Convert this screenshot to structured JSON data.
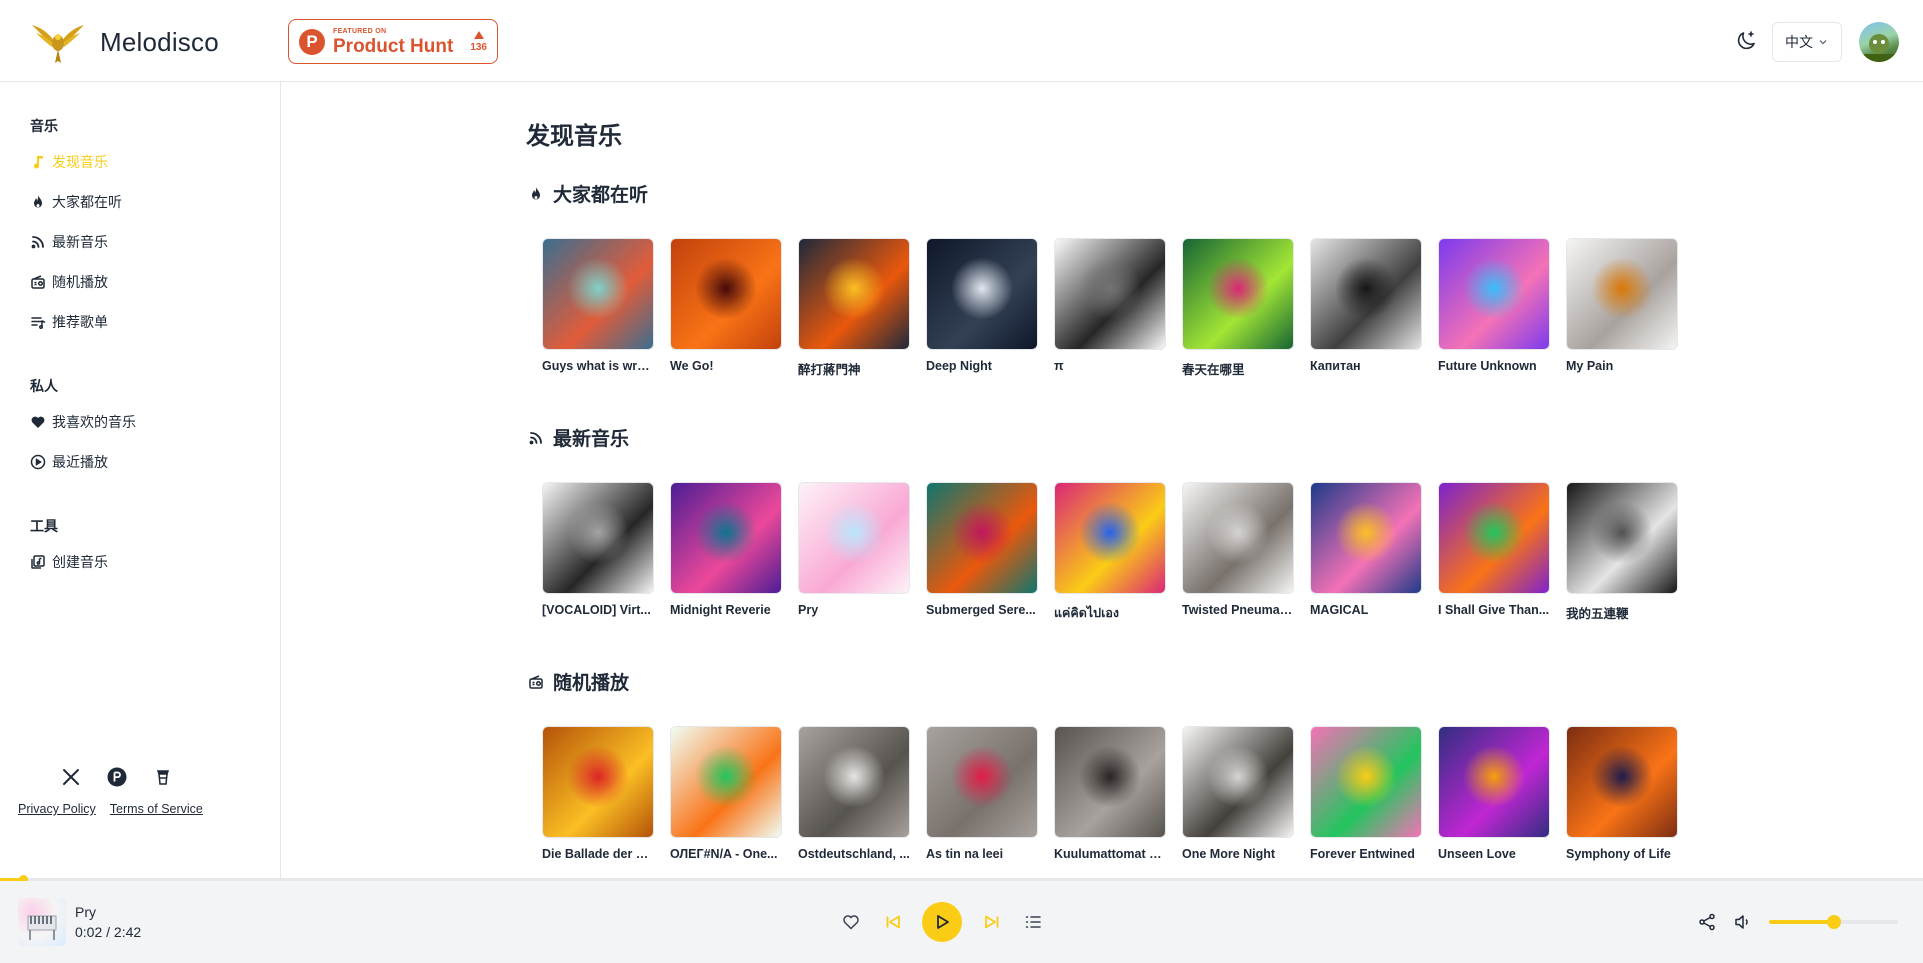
{
  "header": {
    "brand_name": "Melodisco",
    "product_hunt": {
      "featured": "FEATURED ON",
      "name": "Product Hunt",
      "votes": "136",
      "letter": "P"
    },
    "language": "中文"
  },
  "sidebar": {
    "sections": [
      {
        "title": "音乐",
        "items": [
          {
            "label": "发现音乐",
            "icon": "music-note-icon",
            "active": true
          },
          {
            "label": "大家都在听",
            "icon": "flame-icon"
          },
          {
            "label": "最新音乐",
            "icon": "rss-icon"
          },
          {
            "label": "随机播放",
            "icon": "radio-icon"
          },
          {
            "label": "推荐歌单",
            "icon": "playlist-icon"
          }
        ]
      },
      {
        "title": "私人",
        "items": [
          {
            "label": "我喜欢的音乐",
            "icon": "heart-icon"
          },
          {
            "label": "最近播放",
            "icon": "play-circle-icon"
          }
        ]
      },
      {
        "title": "工具",
        "items": [
          {
            "label": "创建音乐",
            "icon": "create-music-icon"
          }
        ]
      }
    ],
    "footer": {
      "privacy": "Privacy Policy",
      "terms": "Terms of Service"
    }
  },
  "main": {
    "page_title": "发现音乐",
    "sections": [
      {
        "title": "大家都在听",
        "icon": "flame-icon",
        "songs": [
          {
            "title": "Guys what is wro...",
            "c1": "#3b6e8f",
            "c2": "#e25c3a",
            "c3": "#7fd1c9"
          },
          {
            "title": "We Go!",
            "c1": "#c2410c",
            "c2": "#f97316",
            "c3": "#450a0a"
          },
          {
            "title": "醉打蔣門神",
            "c1": "#1e293b",
            "c2": "#ea580c",
            "c3": "#fbbf24"
          },
          {
            "title": "Deep Night",
            "c1": "#0f172a",
            "c2": "#334155",
            "c3": "#e2e8f0"
          },
          {
            "title": "π",
            "c1": "#fafafa",
            "c2": "#262626",
            "c3": "#737373"
          },
          {
            "title": "春天在哪里",
            "c1": "#166534",
            "c2": "#a3e635",
            "c3": "#db2777"
          },
          {
            "title": "Капитан",
            "c1": "#e5e5e5",
            "c2": "#404040",
            "c3": "#171717"
          },
          {
            "title": "Future Unknown",
            "c1": "#7c3aed",
            "c2": "#f472b6",
            "c3": "#38bdf8"
          },
          {
            "title": "My Pain",
            "c1": "#f5f5f4",
            "c2": "#a8a29e",
            "c3": "#d97706"
          }
        ]
      },
      {
        "title": "最新音乐",
        "icon": "rss-icon",
        "songs": [
          {
            "title": "[VOCALOID] Virt...",
            "c1": "#f5f5f5",
            "c2": "#262626",
            "c3": "#a3a3a3"
          },
          {
            "title": "Midnight Reverie",
            "c1": "#4c1d95",
            "c2": "#ec4899",
            "c3": "#0e7490"
          },
          {
            "title": "Pry",
            "c1": "#fdf2f8",
            "c2": "#f9a8d4",
            "c3": "#bae6fd"
          },
          {
            "title": "Submerged Sere...",
            "c1": "#0f766e",
            "c2": "#ea580c",
            "c3": "#be185d"
          },
          {
            "title": "แค่คิดไปเอง",
            "c1": "#db2777",
            "c2": "#facc15",
            "c3": "#2563eb"
          },
          {
            "title": "Twisted Pneumat...",
            "c1": "#f5f5f4",
            "c2": "#78716c",
            "c3": "#d6d3d1"
          },
          {
            "title": "MAGICAL",
            "c1": "#1e3a8a",
            "c2": "#f472b6",
            "c3": "#fbbf24"
          },
          {
            "title": "I Shall Give Than...",
            "c1": "#7e22ce",
            "c2": "#f97316",
            "c3": "#22c55e"
          },
          {
            "title": "我的五連鞭",
            "c1": "#171717",
            "c2": "#e5e5e5",
            "c3": "#525252"
          }
        ]
      },
      {
        "title": "随机播放",
        "icon": "radio-icon",
        "songs": [
          {
            "title": "Die Ballade der N...",
            "c1": "#b45309",
            "c2": "#fbbf24",
            "c3": "#dc2626"
          },
          {
            "title": "ОЛЕГ#N/A - One...",
            "c1": "#f0fdf4",
            "c2": "#f97316",
            "c3": "#22c55e"
          },
          {
            "title": "Ostdeutschland, ...",
            "c1": "#a8a29e",
            "c2": "#57534e",
            "c3": "#e7e5e4"
          },
          {
            "title": "As tin na leei",
            "c1": "#a8a29e",
            "c2": "#78716c",
            "c3": "#e11d48"
          },
          {
            "title": "Kuulumattomat S...",
            "c1": "#57534e",
            "c2": "#a8a29e",
            "c3": "#292524"
          },
          {
            "title": "One More Night",
            "c1": "#f5f5f4",
            "c2": "#44403c",
            "c3": "#d6d3d1"
          },
          {
            "title": "Forever Entwined",
            "c1": "#f472b6",
            "c2": "#22c55e",
            "c3": "#facc15"
          },
          {
            "title": "Unseen Love",
            "c1": "#312e81",
            "c2": "#c026d3",
            "c3": "#f59e0b"
          },
          {
            "title": "Symphony of Life",
            "c1": "#7c2d12",
            "c2": "#f97316",
            "c3": "#1e1b4b"
          }
        ]
      }
    ]
  },
  "player": {
    "title": "Pry",
    "time": "0:02 / 2:42",
    "progress": 0.012,
    "volume": 0.5,
    "accent": "#facc15"
  }
}
